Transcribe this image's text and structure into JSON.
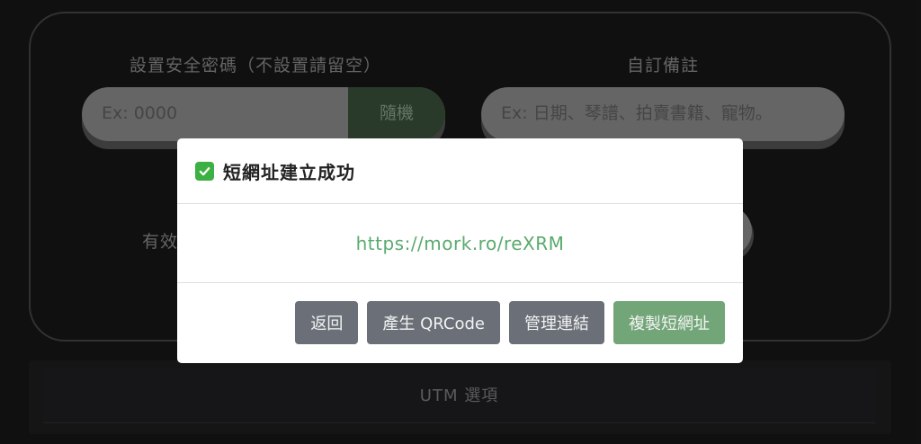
{
  "form": {
    "password_label": "設置安全密碼（不設置請留空）",
    "password_placeholder": "Ex: 0000",
    "random_label": "隨機",
    "note_label": "自訂備註",
    "note_placeholder": "Ex: 日期、琴譜、拍賣書籍、寵物。",
    "expiry_label_partial": "有效"
  },
  "utm": {
    "label": "UTM 選項"
  },
  "modal": {
    "title": "短網址建立成功",
    "title_icon": "check-mark-icon",
    "short_url": "https://mork.ro/reXRM",
    "buttons": {
      "back": "返回",
      "qrcode": "產生 QRCode",
      "manage": "管理連結",
      "copy": "複製短網址"
    }
  },
  "colors": {
    "accent_green": "#72a678",
    "link_green": "#5aaa6e",
    "secondary_button": "#6b7078"
  }
}
